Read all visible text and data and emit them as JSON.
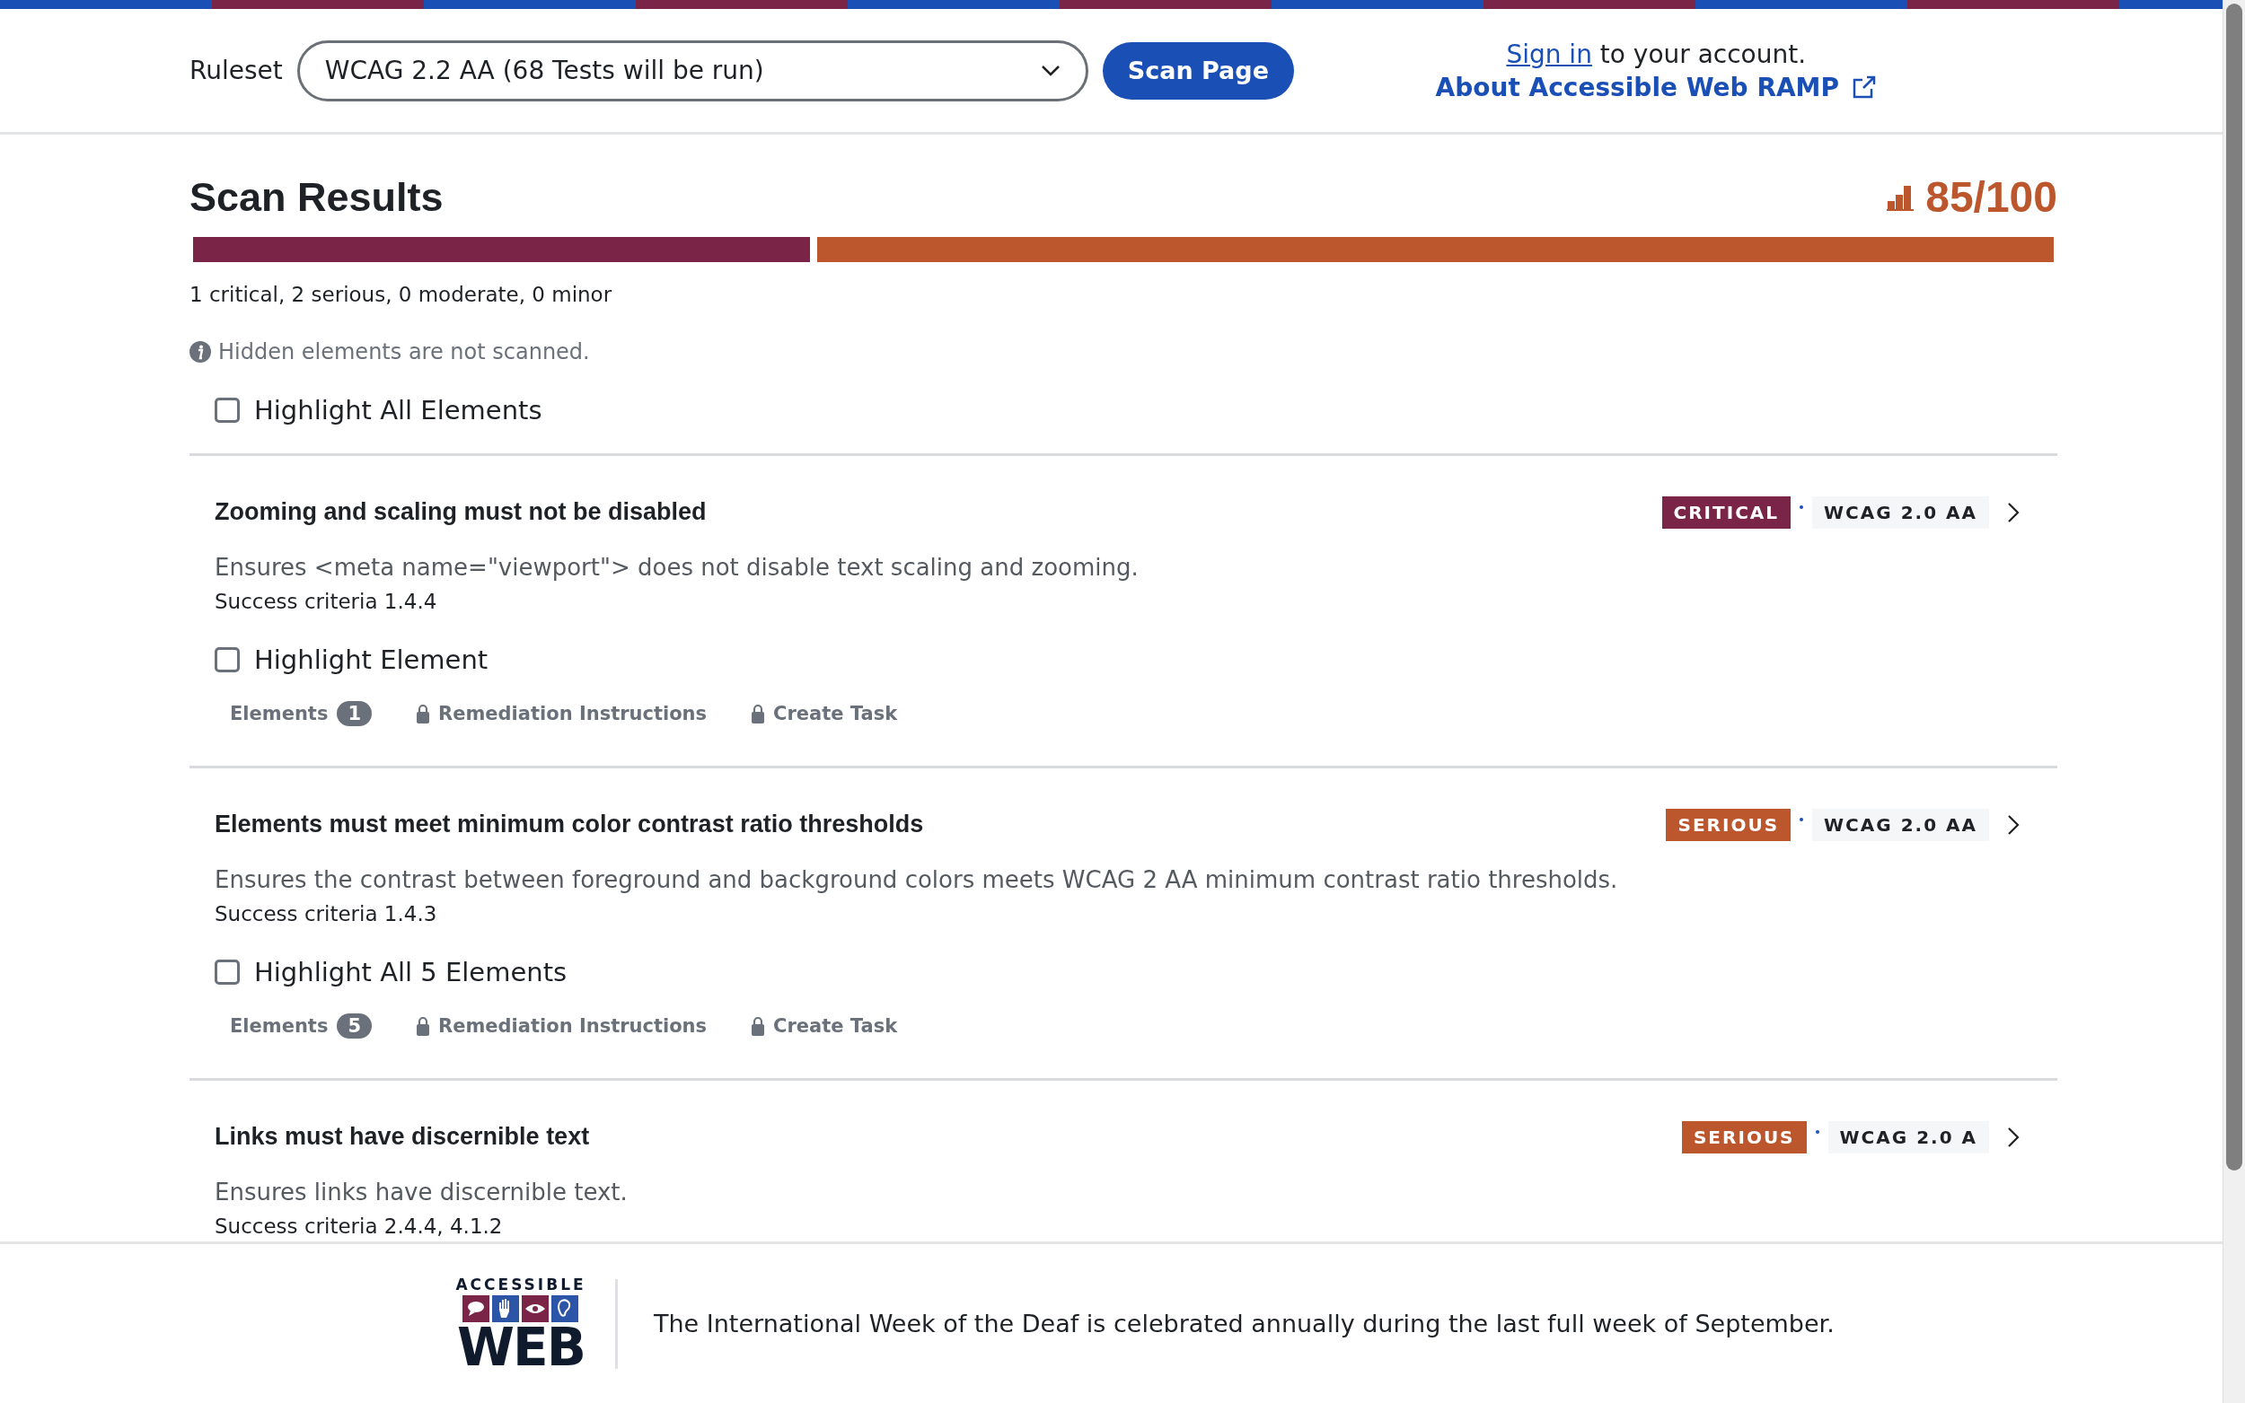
{
  "header": {
    "ruleset_label": "Ruleset",
    "ruleset_value": "WCAG 2.2 AA (68 Tests will be run)",
    "scan_button": "Scan Page",
    "sign_in_link": "Sign in",
    "sign_in_text": "to your account.",
    "about_link": "About Accessible Web RAMP"
  },
  "results": {
    "title": "Scan Results",
    "score": "85/100",
    "segments": [
      {
        "kind": "critical",
        "level": 0.333
      },
      {
        "kind": "serious",
        "level": 0.667
      }
    ],
    "summary": "1 critical, 2 serious, 0 moderate, 0 minor",
    "notice": "Hidden elements are not scanned.",
    "highlight_all": {
      "label": "Highlight All Elements",
      "checked": false
    }
  },
  "issues": [
    {
      "title": "Zooming and scaling must not be disabled",
      "severity": {
        "kind": "critical",
        "label": "CRITICAL"
      },
      "standard": "WCAG 2.0 AA",
      "description": "Ensures <meta name=\"viewport\"> does not disable text scaling and zooming.",
      "criteria": "Success criteria 1.4.4",
      "highlight": {
        "label": "Highlight Element",
        "checked": false
      },
      "elements_label": "Elements",
      "elements_count": "1",
      "remediation": "Remediation Instructions",
      "create_task": "Create Task"
    },
    {
      "title": "Elements must meet minimum color contrast ratio thresholds",
      "severity": {
        "kind": "serious",
        "label": "SERIOUS"
      },
      "standard": "WCAG 2.0 AA",
      "description": "Ensures the contrast between foreground and background colors meets WCAG 2 AA minimum contrast ratio thresholds.",
      "criteria": "Success criteria 1.4.3",
      "highlight": {
        "label": "Highlight All 5 Elements",
        "checked": false
      },
      "elements_label": "Elements",
      "elements_count": "5",
      "remediation": "Remediation Instructions",
      "create_task": "Create Task"
    },
    {
      "title": "Links must have discernible text",
      "severity": {
        "kind": "serious",
        "label": "SERIOUS"
      },
      "standard": "WCAG 2.0 A",
      "description": "Ensures links have discernible text.",
      "criteria": "Success criteria 2.4.4, 4.1.2"
    }
  ],
  "footer": {
    "logo_top": "ACCESSIBLE",
    "logo_bottom": "WEB",
    "message": "The International Week of the Deaf is celebrated annually during the last full week of September."
  }
}
